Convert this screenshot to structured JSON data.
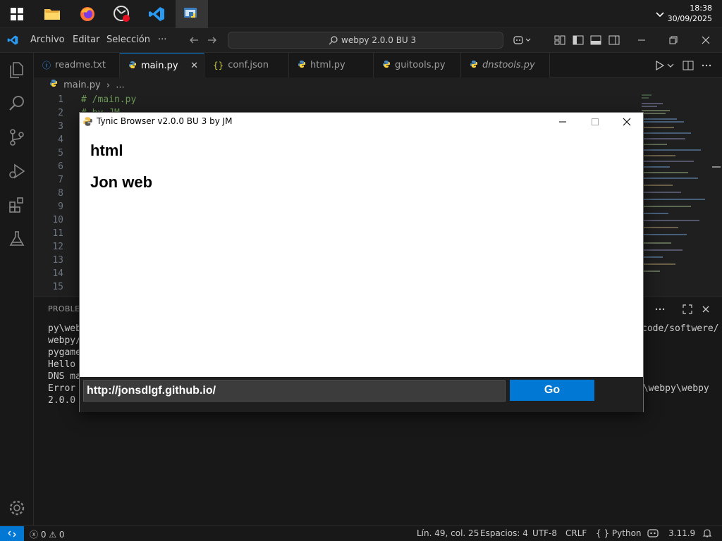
{
  "taskbar": {
    "apps": [
      "file-explorer",
      "firefox",
      "chromium-app",
      "vscode",
      "python-app"
    ],
    "time": "18:38",
    "date": "30/09/2025"
  },
  "titlebar": {
    "menu": [
      "Archivo",
      "Editar",
      "Selección"
    ],
    "more": "···",
    "search_text": "webpy 2.0.0 BU 3"
  },
  "tabs": [
    {
      "label": "readme.txt",
      "icon": "info-icon"
    },
    {
      "label": "main.py",
      "icon": "python-icon",
      "active": true,
      "close": "✕"
    },
    {
      "label": "conf.json",
      "icon": "json-braces-icon",
      "glyph": "{}"
    },
    {
      "label": "html.py",
      "icon": "python-icon"
    },
    {
      "label": "guitools.py",
      "icon": "python-icon"
    },
    {
      "label": "dnstools.py",
      "icon": "python-icon"
    }
  ],
  "breadcrumb": {
    "file": "main.py",
    "more": "..."
  },
  "editor": {
    "line_numbers": [
      "1",
      "2",
      "3",
      "4",
      "5",
      "6",
      "7",
      "8",
      "9",
      "10",
      "11",
      "12",
      "13",
      "14",
      "15"
    ],
    "line1": "# /main.py",
    "line2": "# by JM"
  },
  "panel": {
    "title": "PROBLEM",
    "lines_left": [
      "py\\web",
      "webpy/",
      "pygame",
      "Hello",
      "DNS ma",
      "Error",
      "2.0.0"
    ],
    "lines_right": [
      "code/softwere/",
      "",
      "",
      "",
      "",
      "e\\webpy\\webpy",
      ""
    ]
  },
  "statusbar": {
    "errors": "0",
    "warnings": "0",
    "position": "Lín. 49, col. 25",
    "spaces": "Espacios: 4",
    "encoding": "UTF-8",
    "eol": "CRLF",
    "language_mode": "{ }",
    "language": "Python",
    "version": "3.11.9"
  },
  "tynic": {
    "title": "Tynic Browser v2.0.0 BU 3 by JM",
    "heading1": "html",
    "heading2": "Jon web",
    "url": "http://jonsdlgf.github.io/",
    "go": "Go"
  }
}
